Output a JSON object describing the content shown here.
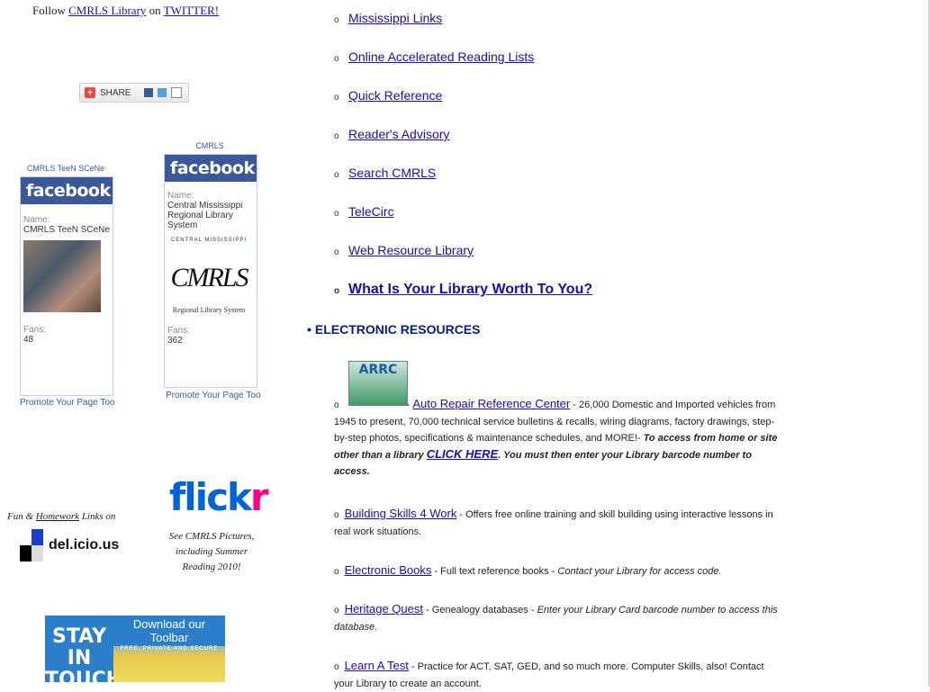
{
  "left": {
    "follow_prefix": "Follow",
    "follow_link1": "CMRLS Library",
    "follow_mid": "on",
    "follow_link2": "TWITTER!",
    "share_label": "SHARE",
    "fb1": {
      "caption": "CMRLS TeeN SCeNe",
      "header": "facebook",
      "name_label": "Name:",
      "name_value": "CMRLS TeeN SCeNe",
      "fans_label": "Fans:",
      "fans_value": "48",
      "promote": "Promote Your Page Too"
    },
    "fb2": {
      "caption": "CMRLS",
      "header": "facebook",
      "name_label": "Name:",
      "name_value": "Central Mississippi Regional Library System",
      "logo_text": "CMRLS",
      "logo_arc": "CENTRAL MISSISSIPPI",
      "logo_sub": "Regional Library System",
      "fans_label": "Fans:",
      "fans_value": "362",
      "promote": "Promote Your Page Too"
    },
    "delicious_caption_prefix": "Fun &",
    "delicious_caption_link": "Homework",
    "delicious_caption_suffix": "Links on",
    "delicious_text": "del.icio.us",
    "flickr_logo": "flickr",
    "flickr_caption": "See CMRLS Pictures, including Summer Reading 2010!",
    "stayintouch": "STAY IN TOUCH",
    "toolbar_title": "Download our Toolbar",
    "toolbar_sub": "FREE, PRIVATE AND SECURE"
  },
  "nav_links": [
    "Mississippi Links",
    "Online Accelerated Reading Lists",
    "Quick Reference",
    "Reader's Advisory",
    "Search CMRLS",
    "TeleCirc",
    "Web Resource Library",
    "What Is Your Library Worth To You?"
  ],
  "section_heading": "ELECTRONIC RESOURCES",
  "resources": [
    {
      "logo": "ARRC",
      "link": "Auto Repair Reference Center",
      "text": " - 26,000 Domestic and Imported vehicles from 1945 to present, 70,000 technical service bulletins & recalls, wiring diagrams, factory drawings, step-by-step photos, specifications & maintenance schedules, and MORE!- ",
      "em1": "To access from home or site other than a library ",
      "click": "CLICK HERE",
      "em2": ". You must then enter your Library barcode number to access."
    },
    {
      "link": "Building Skills 4 Work",
      "text": " - Offers free online training and skill building using interactive lessons in real work situations."
    },
    {
      "link": "Electronic Books",
      "text": " - Full text reference books - ",
      "it": "Contact your Library for access code."
    },
    {
      "link": "Heritage Quest",
      "text": " - Genealogy databases - ",
      "it": "Enter your Library Card barcode number to access this database."
    },
    {
      "link": "Learn A Test",
      "text": "  - Practice for ACT, SAT, GED, and so much more. Computer Skills, also! Contact your Library to create an account."
    }
  ],
  "colors": {
    "facebook": "#3b5998",
    "link": "#1a0dab",
    "heading": "#0a1a8a",
    "flickr_blue": "#0063dc",
    "flickr_pink": "#ff0084"
  }
}
